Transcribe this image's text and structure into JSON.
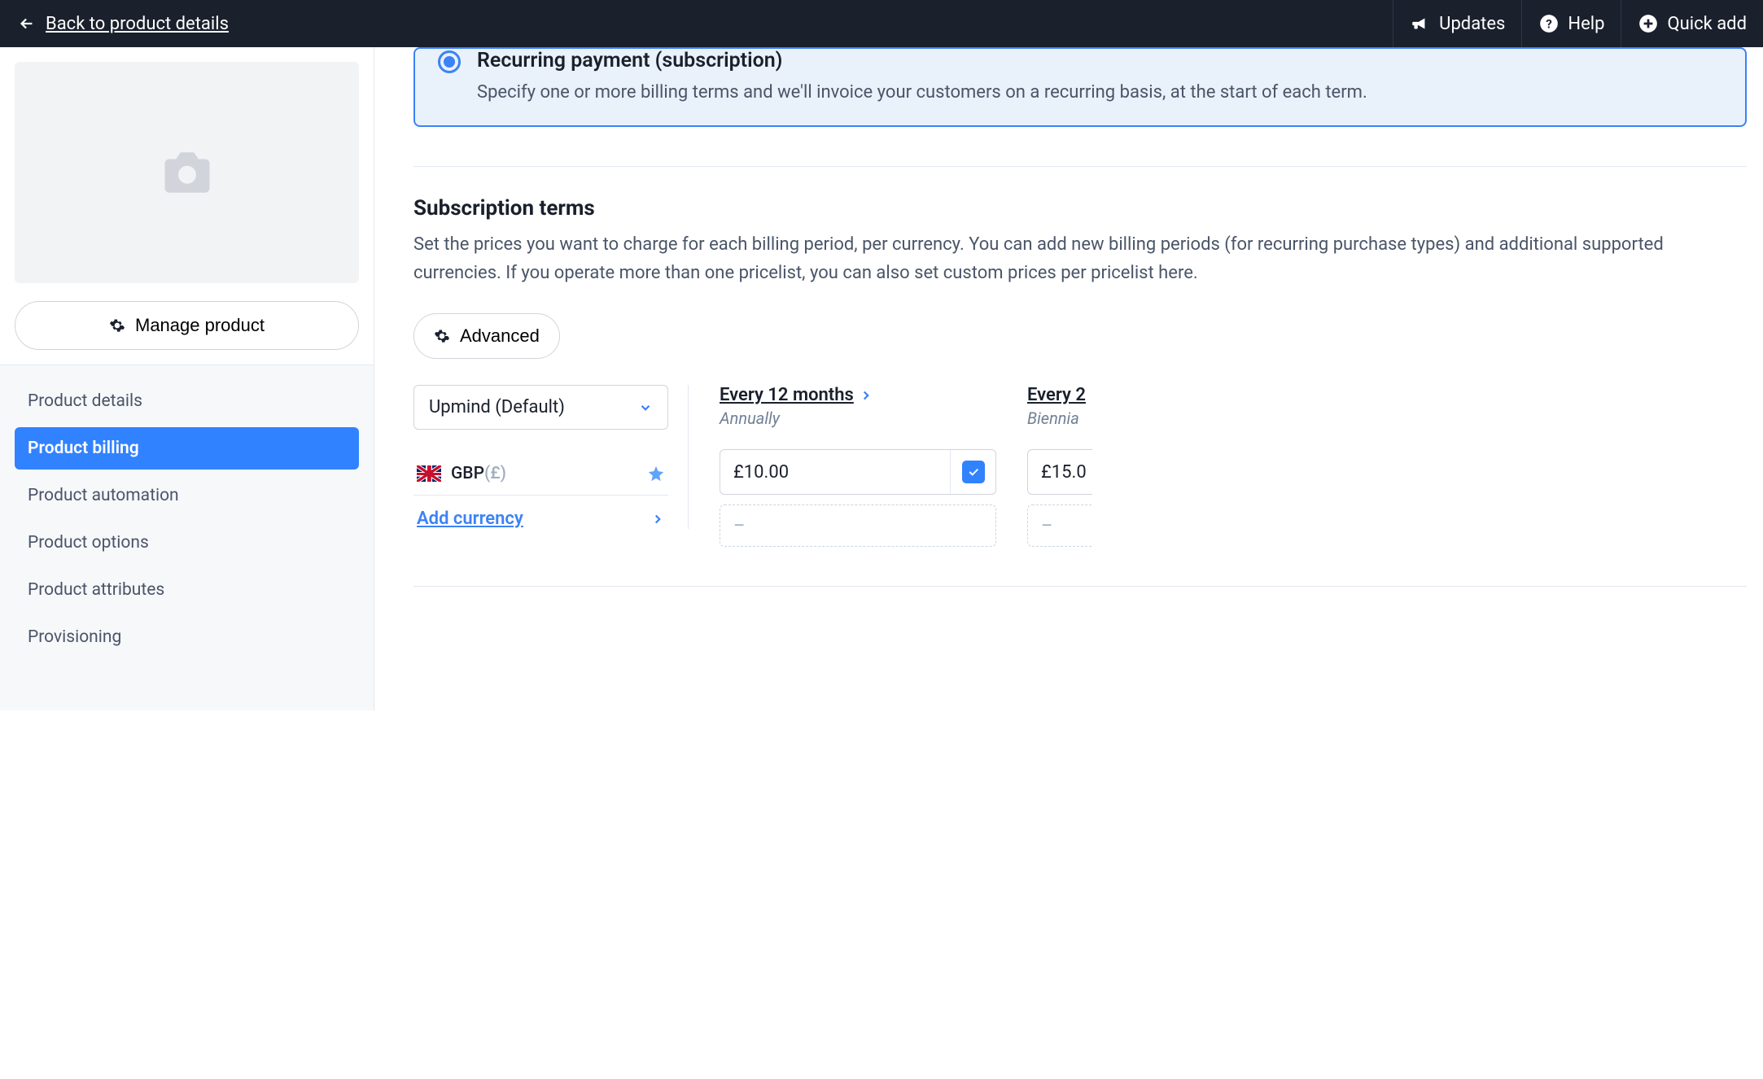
{
  "topbar": {
    "back_label": "Back to product details",
    "updates_label": "Updates",
    "help_label": "Help",
    "quick_add_label": "Quick add"
  },
  "sidebar": {
    "manage_label": "Manage product",
    "nav": [
      {
        "label": "Product details"
      },
      {
        "label": "Product billing"
      },
      {
        "label": "Product automation"
      },
      {
        "label": "Product options"
      },
      {
        "label": "Product attributes"
      },
      {
        "label": "Provisioning"
      }
    ],
    "active_index": 1
  },
  "radio": {
    "title": "Recurring payment (subscription)",
    "desc": "Specify one or more billing terms and we'll invoice your customers on a recurring basis, at the start of each term."
  },
  "section": {
    "heading": "Subscription terms",
    "desc": "Set the prices you want to charge for each billing period, per currency. You can add new billing periods (for recurring purchase types) and additional supported currencies. If you operate more than one pricelist, you can also set custom prices per pricelist here.",
    "advanced_label": "Advanced"
  },
  "pricelist_select": "Upmind (Default)",
  "currency": {
    "code": "GBP",
    "symbol": "(£)",
    "add_label": "Add currency"
  },
  "periods": [
    {
      "title": "Every 12 months",
      "sub": "Annually",
      "price": "£10.00",
      "checked": true
    },
    {
      "title": "Every 2",
      "sub": "Biennia",
      "price": "£15.0",
      "checked": false
    }
  ],
  "dashed_placeholder": "–"
}
